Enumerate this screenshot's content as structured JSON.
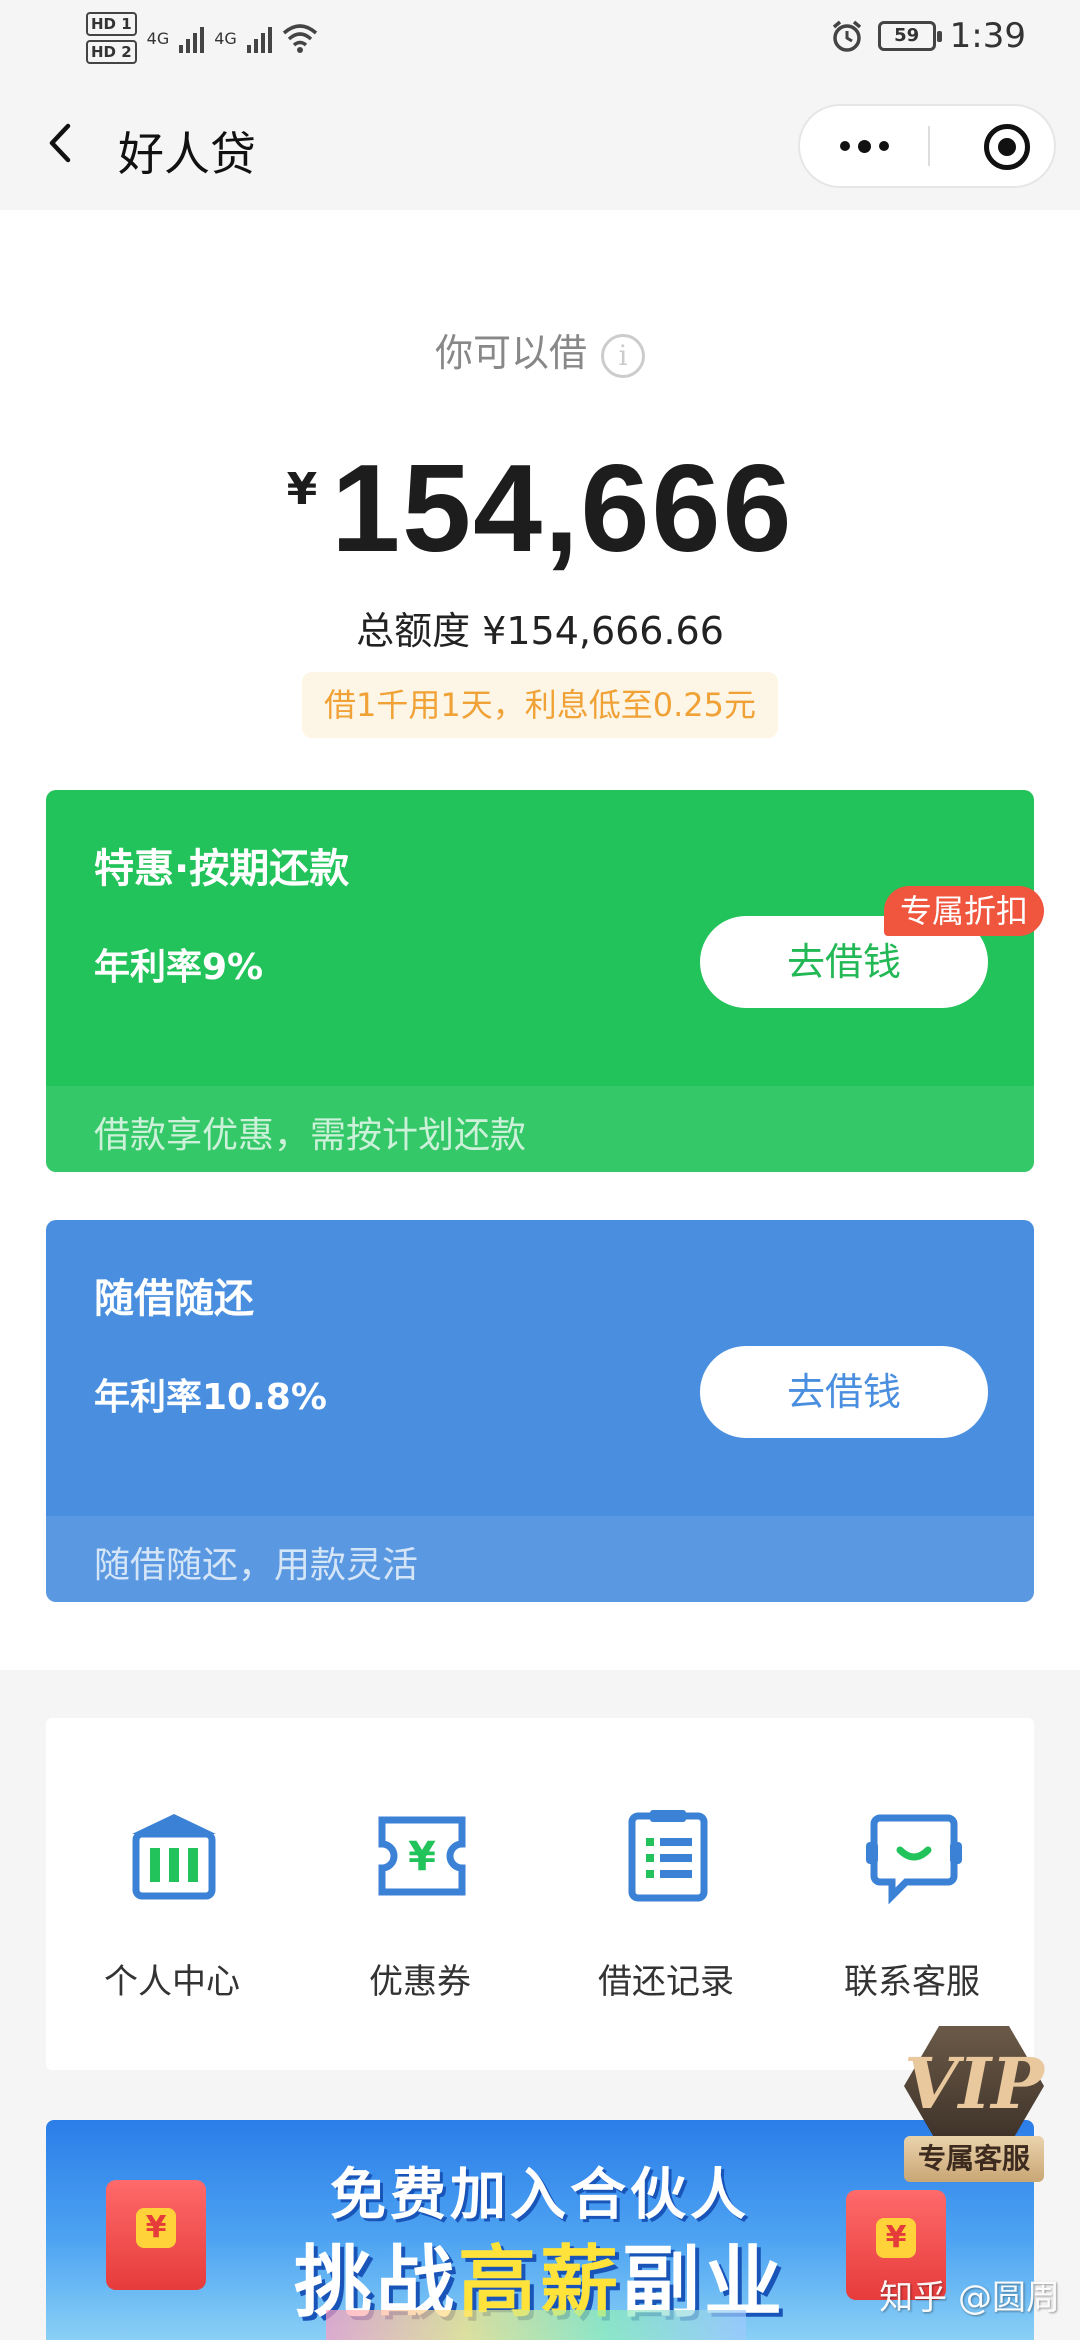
{
  "status_bar": {
    "sim1": "HD 1",
    "sim2": "HD 2",
    "net1": "4G",
    "net2": "4G",
    "battery": "59",
    "time": "1:39",
    "icons": [
      "signal-icon",
      "wifi-icon",
      "alarm-icon",
      "battery-icon"
    ]
  },
  "nav": {
    "title": "好人贷",
    "back_icon": "chevron-left-icon",
    "more_icon": "more-dots-icon",
    "close_icon": "target-close-icon"
  },
  "hero": {
    "label": "你可以借",
    "info_icon": "i",
    "currency": "¥",
    "amount": "154,666",
    "total": "总额度 ¥154,666.66",
    "promo": "借1千用1天，利息低至0.25元"
  },
  "cards": [
    {
      "title": "特惠·按期还款",
      "rate": "年利率9%",
      "button": "去借钱",
      "badge": "专属折扣",
      "footer": "借款享优惠，需按计划还款",
      "color": "#22c35a"
    },
    {
      "title": "随借随还",
      "rate": "年利率10.8%",
      "button": "去借钱",
      "footer": "随借随还，用款灵活",
      "color": "#4a8fdf"
    }
  ],
  "menu": [
    {
      "label": "个人中心",
      "icon": "bank-icon"
    },
    {
      "label": "优惠券",
      "icon": "coupon-icon"
    },
    {
      "label": "借还记录",
      "icon": "record-list-icon"
    },
    {
      "label": "联系客服",
      "icon": "customer-service-icon"
    }
  ],
  "banner": {
    "line1": "免费加入合伙人",
    "line2_a": "挑战",
    "line2_hl": "高薪",
    "line2_b": "副业"
  },
  "vip": {
    "text": "VIP",
    "label": "专属客服"
  },
  "watermark": "知乎 @圆周",
  "colors": {
    "accent_green": "#22c35a",
    "accent_blue": "#4a8fdf",
    "promo_orange": "#f0a237",
    "badge_red": "#f0553e",
    "icon_blue": "#3b82d6"
  }
}
